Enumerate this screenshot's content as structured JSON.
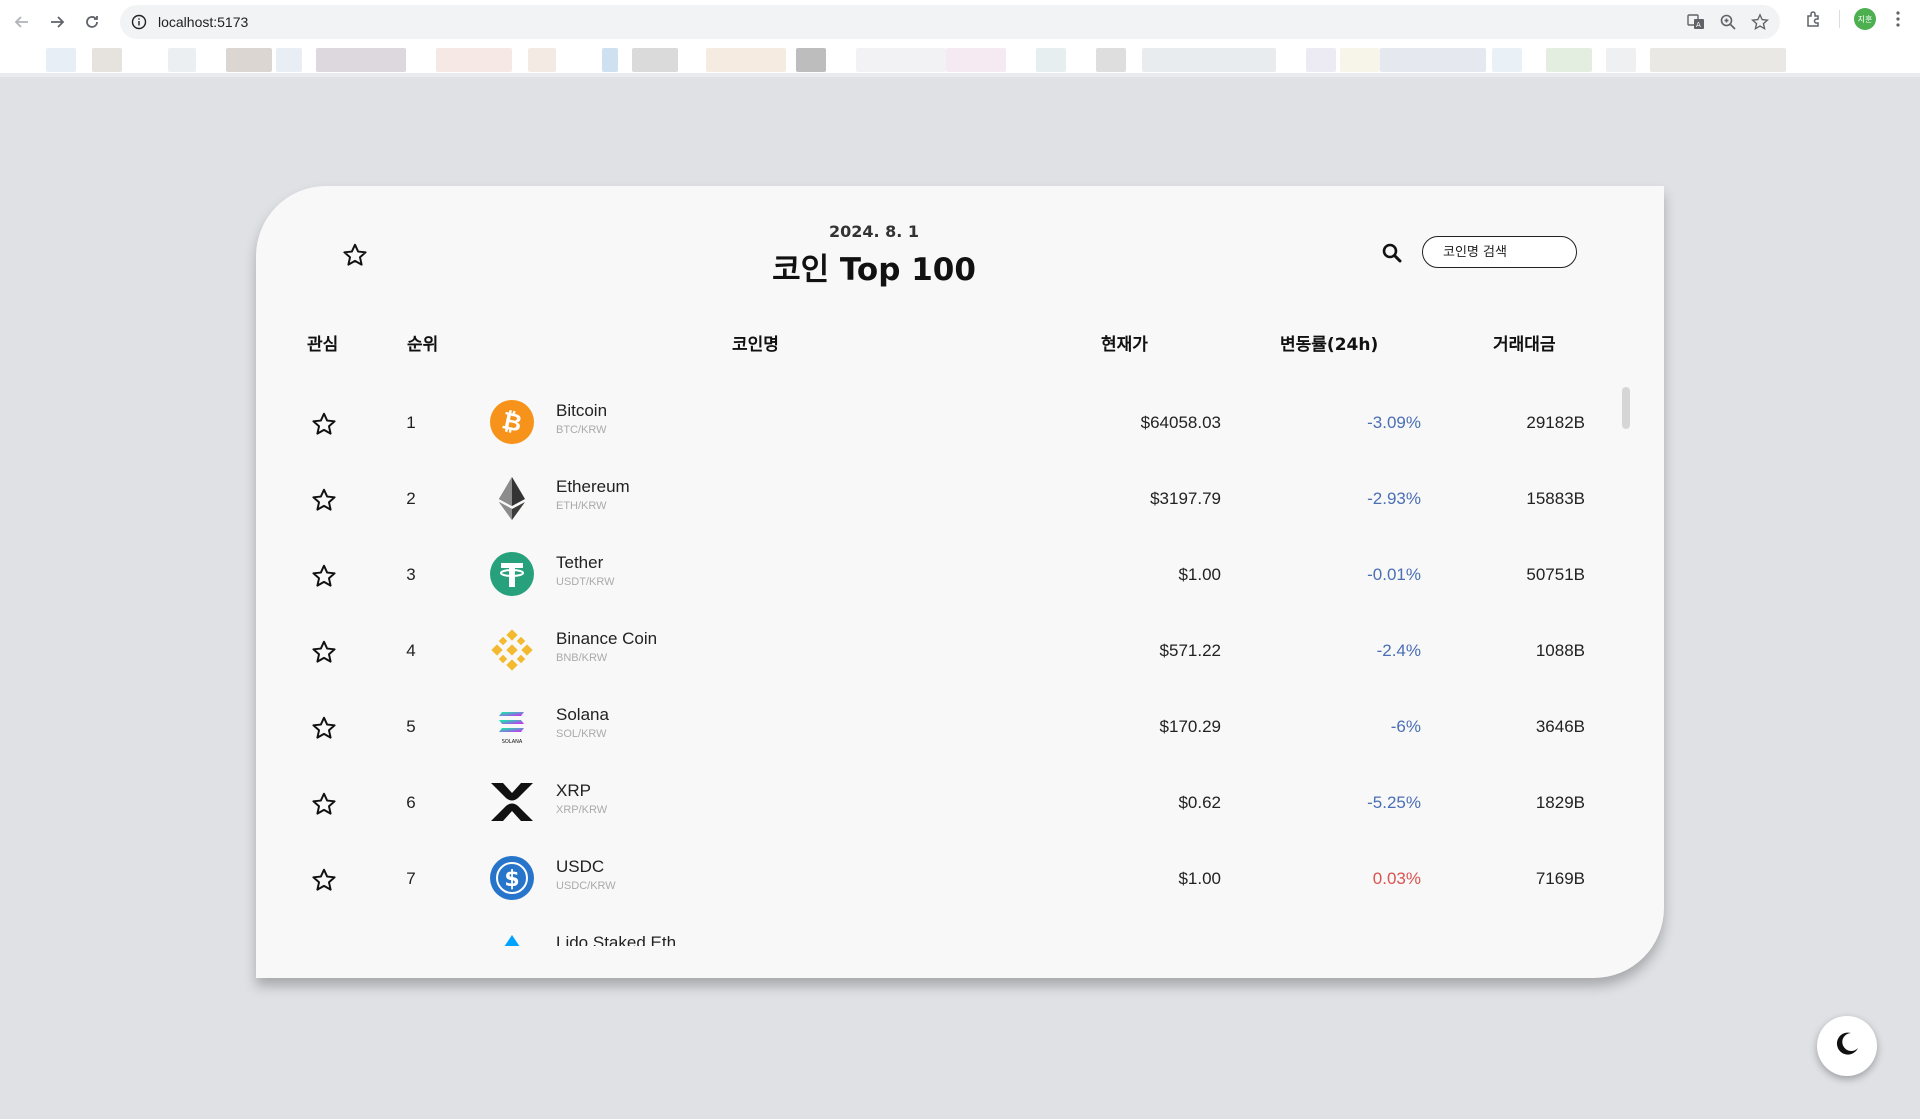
{
  "browser": {
    "url": "localhost:5173",
    "profile_initials": "지훈"
  },
  "header": {
    "date": "2024. 8. 1",
    "title": "코인 Top 100",
    "search_placeholder": "코인명 검색"
  },
  "columns": {
    "favorite": "관심",
    "rank": "순위",
    "name": "코인명",
    "price": "현재가",
    "change": "변동률(24h)",
    "volume": "거래대금"
  },
  "colors": {
    "negative": "#4a6fb5",
    "positive": "#d9534f"
  },
  "coins": [
    {
      "rank": "1",
      "name": "Bitcoin",
      "pair": "BTC/KRW",
      "price": "$64058.03",
      "change": "-3.09%",
      "volume": "29182B",
      "logo": "bitcoin-logo",
      "direction": "down"
    },
    {
      "rank": "2",
      "name": "Ethereum",
      "pair": "ETH/KRW",
      "price": "$3197.79",
      "change": "-2.93%",
      "volume": "15883B",
      "logo": "ethereum-logo",
      "direction": "down"
    },
    {
      "rank": "3",
      "name": "Tether",
      "pair": "USDT/KRW",
      "price": "$1.00",
      "change": "-0.01%",
      "volume": "50751B",
      "logo": "tether-logo",
      "direction": "down"
    },
    {
      "rank": "4",
      "name": "Binance Coin",
      "pair": "BNB/KRW",
      "price": "$571.22",
      "change": "-2.4%",
      "volume": "1088B",
      "logo": "binance-logo",
      "direction": "down"
    },
    {
      "rank": "5",
      "name": "Solana",
      "pair": "SOL/KRW",
      "price": "$170.29",
      "change": "-6%",
      "volume": "3646B",
      "logo": "solana-logo",
      "direction": "down"
    },
    {
      "rank": "6",
      "name": "XRP",
      "pair": "XRP/KRW",
      "price": "$0.62",
      "change": "-5.25%",
      "volume": "1829B",
      "logo": "xrp-logo",
      "direction": "down"
    },
    {
      "rank": "7",
      "name": "USDC",
      "pair": "USDC/KRW",
      "price": "$1.00",
      "change": "0.03%",
      "volume": "7169B",
      "logo": "usdc-logo",
      "direction": "up"
    },
    {
      "rank": "",
      "name": "Lido Staked Eth",
      "pair": "",
      "price": "",
      "change": "",
      "volume": "",
      "logo": "lido-logo",
      "direction": "down"
    }
  ]
}
